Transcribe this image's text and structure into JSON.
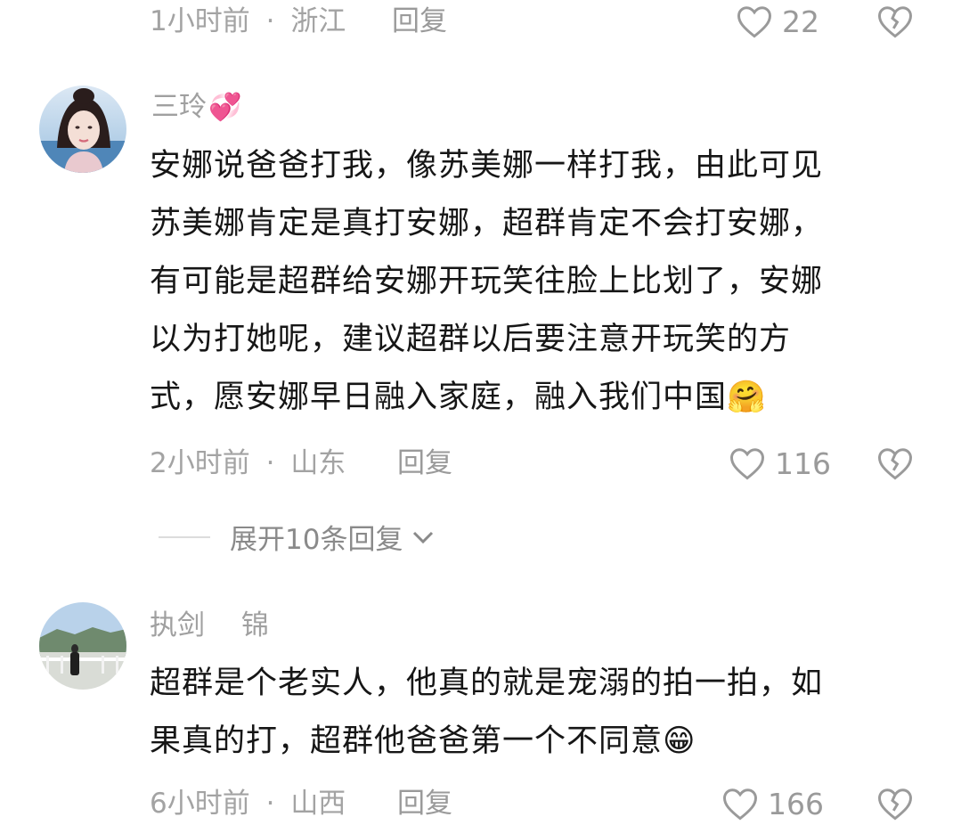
{
  "top_comment": {
    "meta_time": "1小时前",
    "meta_dot": "·",
    "meta_region": "浙江",
    "reply_label": "回复",
    "like_count": "22"
  },
  "comments": [
    {
      "username": "三玲",
      "text_lines": [
        "安娜说爸爸打我，像苏美娜一样打我，由此可见",
        "苏美娜肯定是真打安娜，超群肯定不会打安娜，",
        "有可能是超群给安娜开玩笑往脸上比划了，安娜",
        "以为打她呢，建议超群以后要注意开玩笑的方",
        "式，愿安娜早日融入家庭，融入我们中国"
      ],
      "trailing_emoji": "🤗",
      "name_emoji": "💞",
      "meta_time": "2小时前",
      "meta_dot": "·",
      "meta_region": "山东",
      "reply_label": "回复",
      "like_count": "116"
    },
    {
      "username": "执剑　 锦",
      "text_lines": [
        "超群是个老实人，他真的就是宠溺的拍一拍，如",
        "果真的打，超群他爸爸第一个不同意"
      ],
      "trailing_emoji": "😁",
      "meta_time": "6小时前",
      "meta_dot": "·",
      "meta_region": "山西",
      "reply_label": "回复",
      "like_count": "166"
    }
  ],
  "expand_replies_label": "展开10条回复",
  "icons": {
    "like": "heart-outline-icon",
    "dislike": "broken-heart-icon",
    "expand": "chevron-down-icon"
  },
  "colors": {
    "text": "#161616",
    "meta": "#a3a3a3",
    "icon": "#9a9a9a"
  }
}
